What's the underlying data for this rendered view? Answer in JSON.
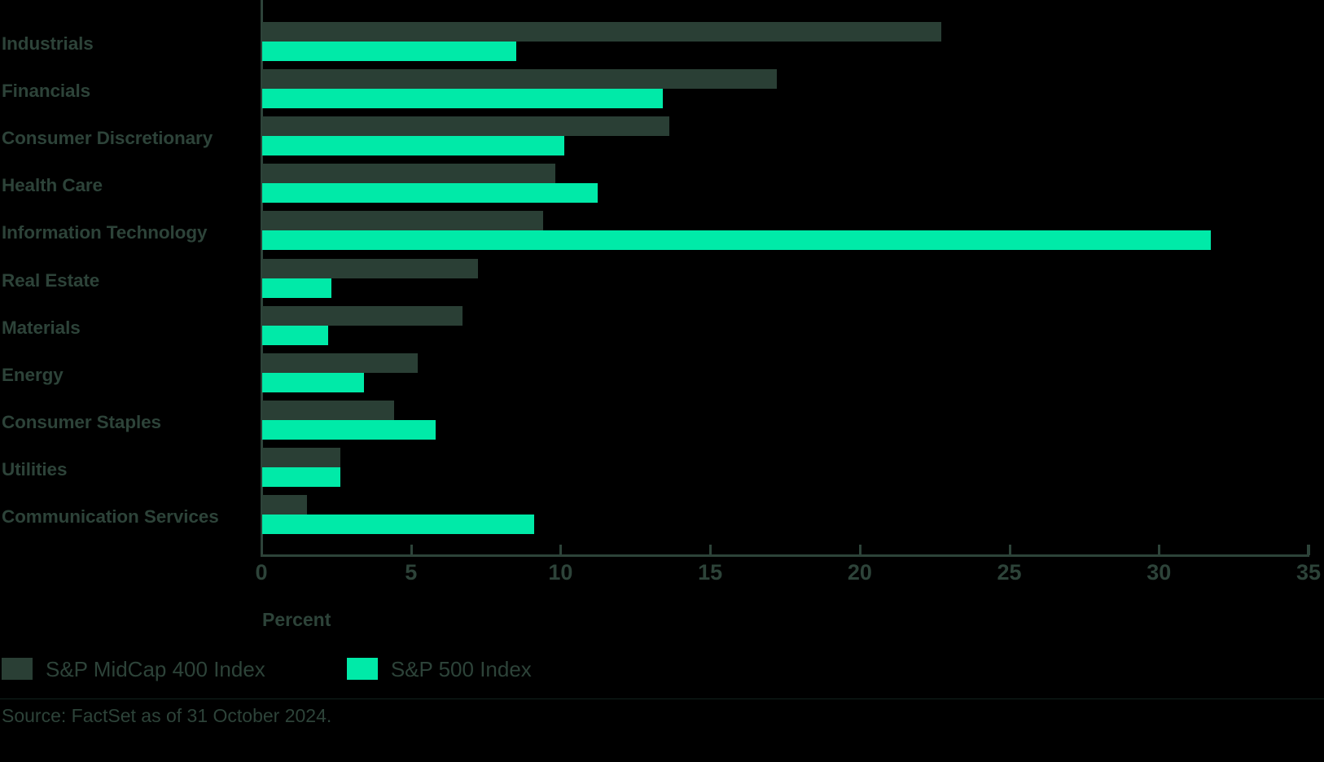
{
  "chart_data": {
    "type": "bar",
    "orientation": "horizontal",
    "title": "",
    "xlabel": "Percent",
    "ylabel": "",
    "xlim": [
      0,
      35
    ],
    "xticks": [
      0,
      5,
      10,
      15,
      20,
      25,
      30,
      35
    ],
    "xtick_labels": [
      "0",
      "5",
      "10",
      "15",
      "20",
      "25",
      "30",
      "35"
    ],
    "grid": false,
    "legend_position": "bottom-left",
    "categories": [
      "Industrials",
      "Financials",
      "Consumer Discretionary",
      "Health Care",
      "Information Technology",
      "Real Estate",
      "Materials",
      "Energy",
      "Consumer Staples",
      "Utilities",
      "Communication Services"
    ],
    "series": [
      {
        "name": "S&P MidCap 400 Index",
        "color": "#2a3f35",
        "values": [
          22.7,
          17.2,
          13.6,
          9.8,
          9.4,
          7.2,
          6.7,
          5.2,
          4.4,
          2.6,
          1.5
        ]
      },
      {
        "name": "S&P 500 Index",
        "color": "#00eaa8",
        "values": [
          8.5,
          13.4,
          10.1,
          11.2,
          31.7,
          2.3,
          2.2,
          3.4,
          5.8,
          2.6,
          9.1
        ]
      }
    ],
    "source": "Source: FactSet as of 31 October 2024.",
    "text_color": "#2d4339",
    "background_color": "#000000"
  }
}
